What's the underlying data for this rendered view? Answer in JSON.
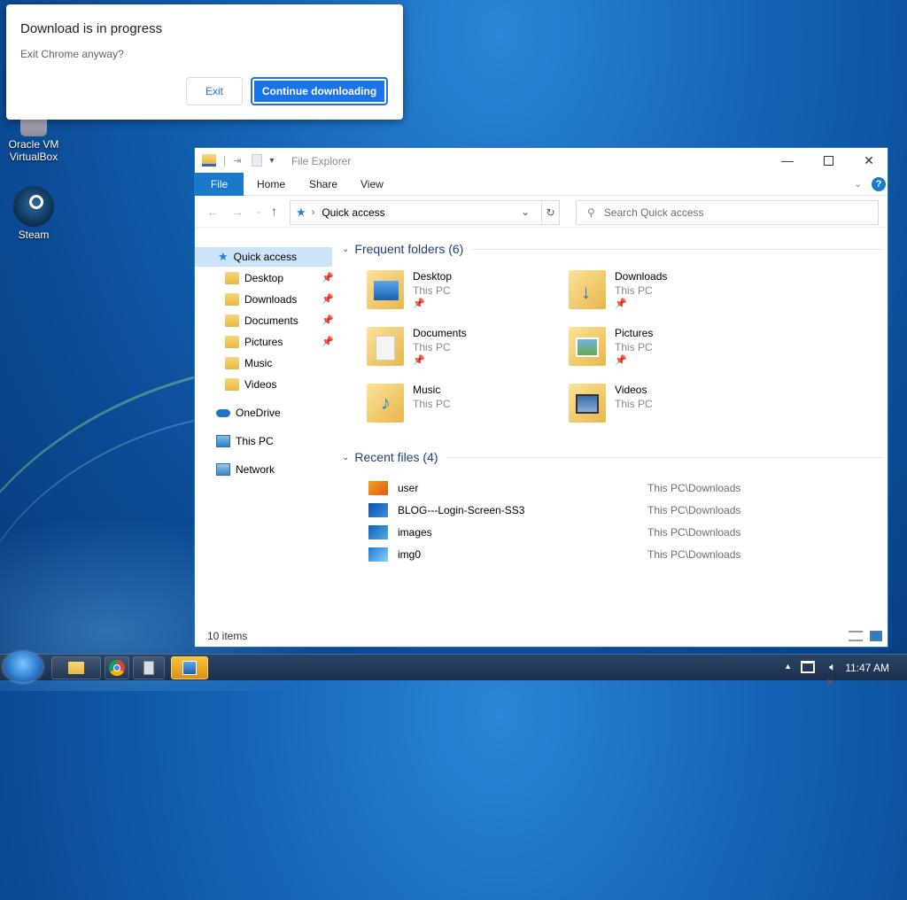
{
  "desktop": {
    "icons": [
      {
        "label_line1": "Oracle VM",
        "label_line2": "VirtualBox"
      },
      {
        "label": "Steam"
      }
    ]
  },
  "dialog": {
    "title": "Download is in progress",
    "subtitle": "Exit Chrome anyway?",
    "exit_label": "Exit",
    "continue_label": "Continue downloading"
  },
  "explorer": {
    "title": "File Explorer",
    "tabs": [
      "File",
      "Home",
      "Share",
      "View"
    ],
    "address": "Quick access",
    "search_placeholder": "Search Quick access",
    "nav": {
      "quick_access": "Quick access",
      "pinned": [
        "Desktop",
        "Downloads",
        "Documents",
        "Pictures"
      ],
      "unpinned": [
        "Music",
        "Videos"
      ],
      "onedrive": "OneDrive",
      "this_pc": "This PC",
      "network": "Network"
    },
    "frequent_header": "Frequent folders (6)",
    "folders": [
      {
        "name": "Desktop",
        "loc": "This PC",
        "pinned": true
      },
      {
        "name": "Downloads",
        "loc": "This PC",
        "pinned": true
      },
      {
        "name": "Documents",
        "loc": "This PC",
        "pinned": true
      },
      {
        "name": "Pictures",
        "loc": "This PC",
        "pinned": true
      },
      {
        "name": "Music",
        "loc": "This PC",
        "pinned": false
      },
      {
        "name": "Videos",
        "loc": "This PC",
        "pinned": false
      }
    ],
    "recent_header": "Recent files (4)",
    "recent": [
      {
        "name": "user",
        "loc": "This PC\\Downloads"
      },
      {
        "name": "BLOG---Login-Screen-SS3",
        "loc": "This PC\\Downloads"
      },
      {
        "name": "images",
        "loc": "This PC\\Downloads"
      },
      {
        "name": "img0",
        "loc": "This PC\\Downloads"
      }
    ],
    "status": "10 items"
  },
  "taskbar": {
    "clock": "11:47 AM"
  },
  "colors": {
    "accent": "#1a73e8",
    "explorer_blue": "#1979ca",
    "folder_yellow": "#e8b840"
  }
}
